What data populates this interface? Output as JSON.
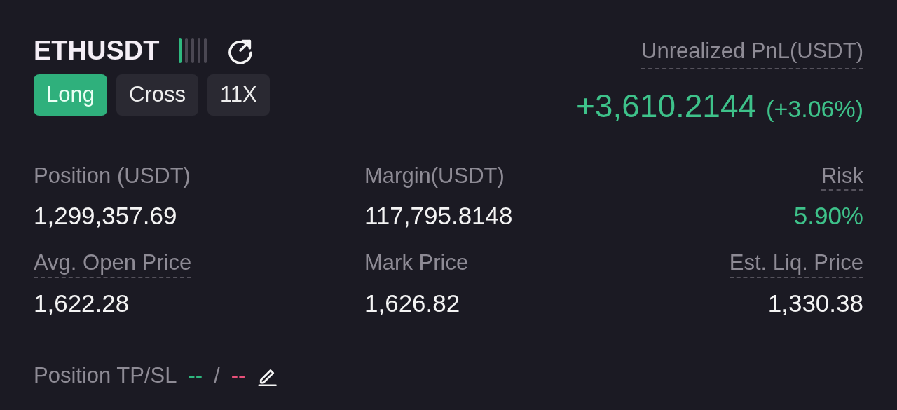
{
  "symbol": "ETHUSDT",
  "risk_meter": {
    "level": 0.2
  },
  "tags": [
    {
      "label": "Long",
      "highlighted": true
    },
    {
      "label": "Cross",
      "highlighted": false
    },
    {
      "label": "11X",
      "highlighted": false
    }
  ],
  "pnl": {
    "label": "Unrealized PnL(USDT)",
    "value": "+3,610.2144",
    "percent": "(+3.06%)"
  },
  "stats": [
    {
      "label": "Position (USDT)",
      "value": "1,299,357.69",
      "underlined": false,
      "positive": false
    },
    {
      "label": "Margin(USDT)",
      "value": "117,795.8148",
      "underlined": false,
      "positive": false
    },
    {
      "label": "Risk",
      "value": "5.90%",
      "underlined": true,
      "positive": true
    },
    {
      "label": "Avg. Open Price",
      "value": "1,622.28",
      "underlined": true,
      "positive": false
    },
    {
      "label": "Mark Price",
      "value": "1,626.82",
      "underlined": false,
      "positive": false
    },
    {
      "label": "Est. Liq. Price",
      "value": "1,330.38",
      "underlined": true,
      "positive": false
    }
  ],
  "tpsl": {
    "label": "Position TP/SL",
    "tp": "--",
    "separator": "/",
    "sl": "--"
  }
}
